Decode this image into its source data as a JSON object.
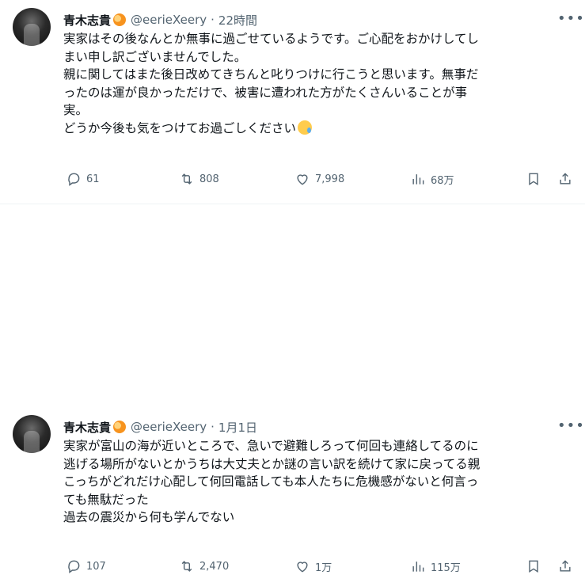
{
  "tweets": [
    {
      "name": "青木志貴",
      "handle": "@eerieXeery",
      "separator": "·",
      "time": "22時間",
      "lines": [
        "実家はその後なんとか無事に過ごせているようです。ご心配をおかけしてし",
        "まい申し訳ございませんでした。",
        "親に関してはまた後日改めてきちんと叱りつけに行こうと思います。無事だ",
        "ったのは運が良かっただけで、被害に遭われた方がたくさんいることが事",
        "実。",
        "どうか今後も気をつけてお過ごしください"
      ],
      "stats": {
        "replies": "61",
        "retweets": "808",
        "likes": "7,998",
        "views": "68万"
      }
    },
    {
      "name": "青木志貴",
      "handle": "@eerieXeery",
      "separator": "·",
      "time": "1月1日",
      "lines": [
        "実家が富山の海が近いところで、急いで避難しろって何回も連絡してるのに",
        "逃げる場所がないとかうちは大丈夫とか謎の言い訳を続けて家に戻ってる親",
        "こっちがどれだけ心配して何回電話しても本人たちに危機感がないと何言っ",
        "ても無駄だった",
        "過去の震災から何も学んでない"
      ],
      "stats": {
        "replies": "107",
        "retweets": "2,470",
        "likes": "1万",
        "views": "115万"
      }
    }
  ],
  "icons": {
    "more": "more-icon",
    "reply": "reply-icon",
    "retweet": "retweet-icon",
    "like": "heart-icon",
    "views": "views-icon",
    "bookmark": "bookmark-icon",
    "share": "share-icon",
    "emoji": "sad-tear-emoji"
  },
  "colors": {
    "text": "#0f1419",
    "secondary": "#536471",
    "divider": "#eff3f4"
  }
}
